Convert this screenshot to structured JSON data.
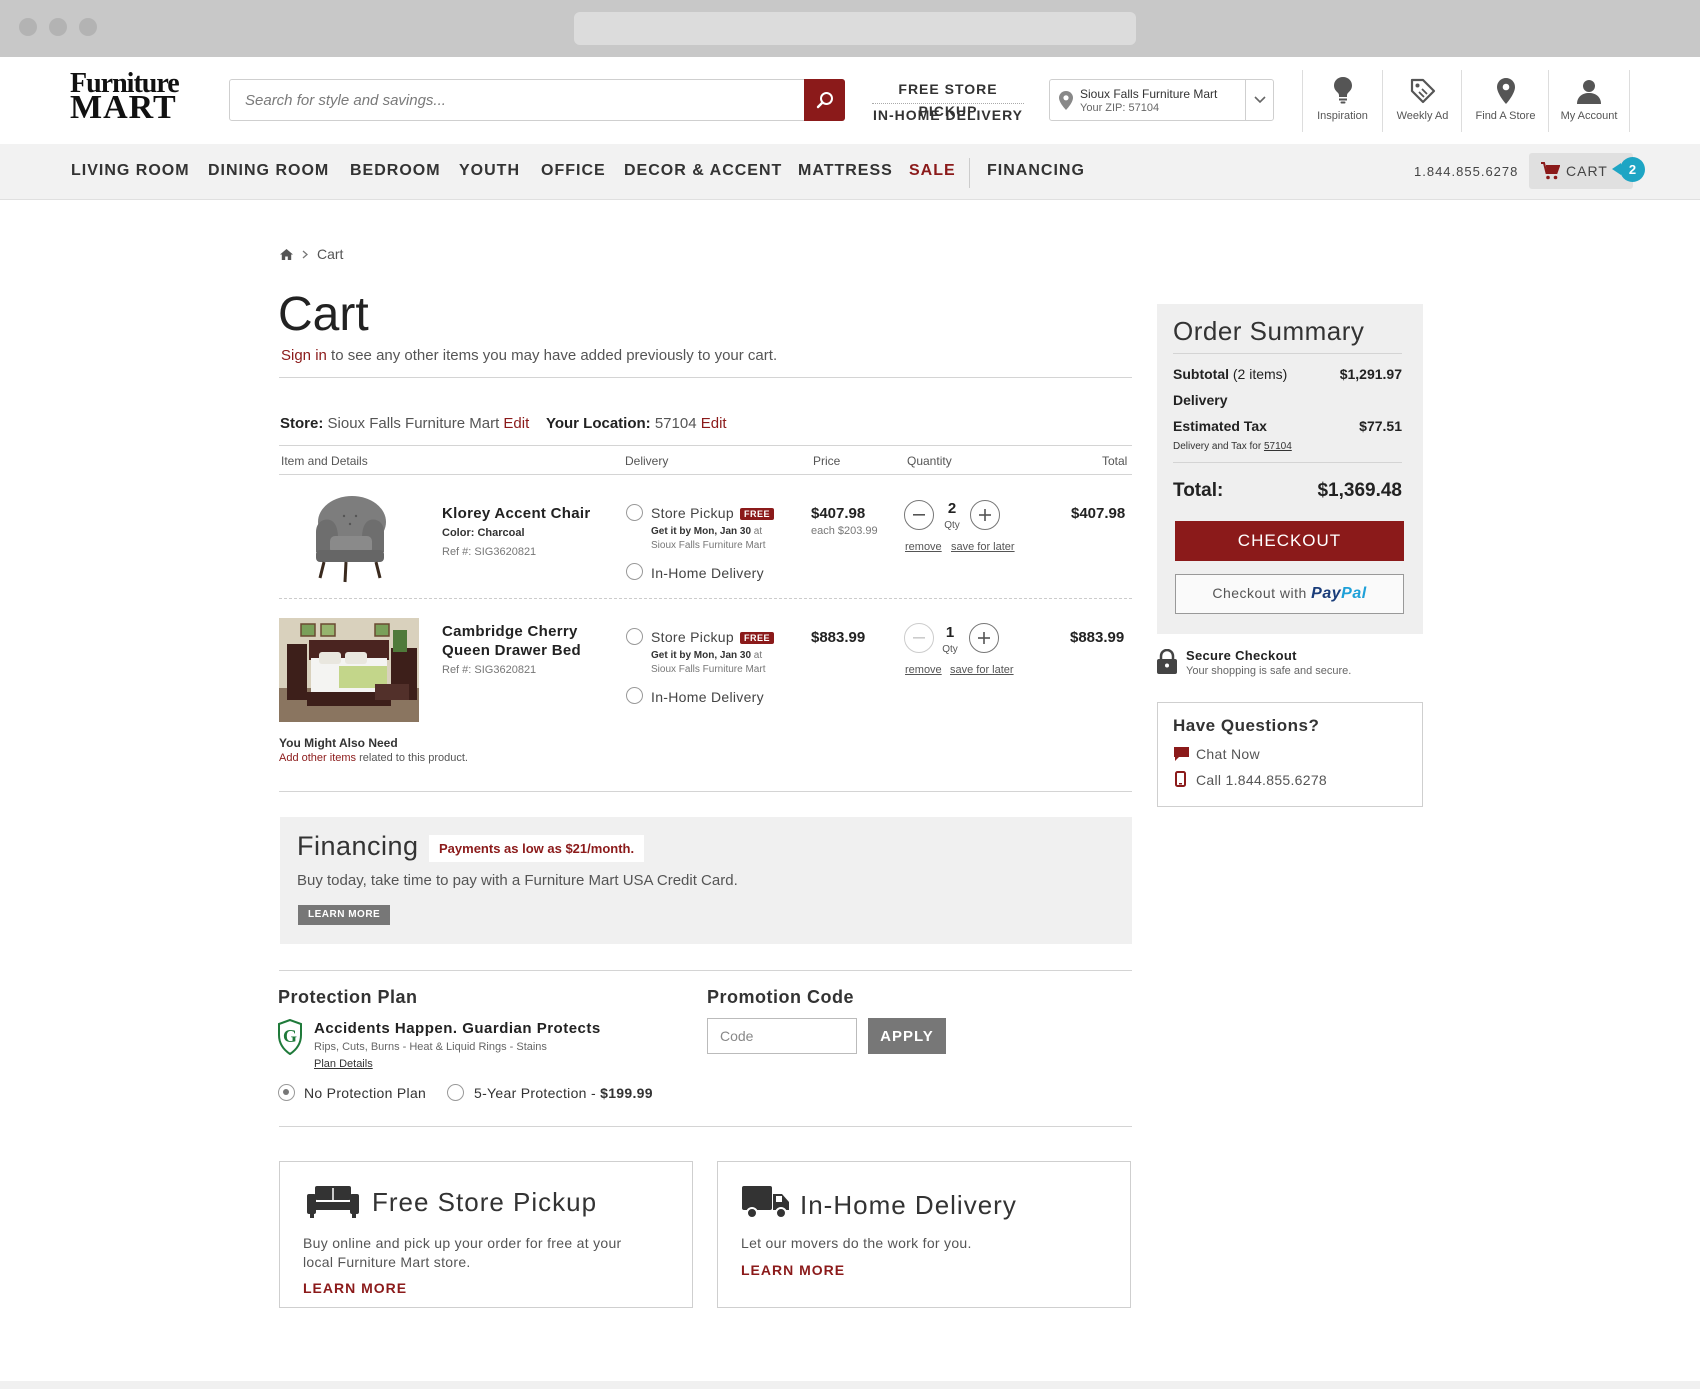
{
  "logo": {
    "line1": "Furniture",
    "line2": "MART"
  },
  "search": {
    "placeholder": "Search for style and savings..."
  },
  "header_links": {
    "pickup": "FREE STORE PICKUP",
    "delivery": "IN-HOME DELIVERY"
  },
  "store_selector": {
    "store": "Sioux Falls Furniture Mart",
    "zip": "Your ZIP: 57104"
  },
  "utility": [
    {
      "label": "Inspiration",
      "icon": "lightbulb-icon"
    },
    {
      "label": "Weekly Ad",
      "icon": "tag-icon"
    },
    {
      "label": "Find A Store",
      "icon": "map-pin-icon"
    },
    {
      "label": "My Account",
      "icon": "user-icon"
    }
  ],
  "nav": {
    "items": [
      "LIVING ROOM",
      "DINING ROOM",
      "BEDROOM",
      "YOUTH",
      "OFFICE",
      "DECOR & ACCENT",
      "MATTRESS",
      "SALE"
    ],
    "financing": "FINANCING",
    "phone": "1.844.855.6278",
    "cart_label": "CART",
    "cart_count": "2"
  },
  "breadcrumb": {
    "current": "Cart"
  },
  "page": {
    "title": "Cart",
    "signin_link": "Sign in",
    "signin_text": " to see any other items you may have added previously to your cart."
  },
  "location": {
    "store_label": "Store:",
    "store_name": "Sioux Falls Furniture Mart",
    "edit": "Edit",
    "location_label": "Your Location:",
    "zip": "57104"
  },
  "table_headers": [
    "Item and Details",
    "Delivery",
    "Price",
    "Quantity",
    "Total"
  ],
  "cart_items": [
    {
      "name": "Klorey Accent Chair",
      "color": "Color: Charcoal",
      "ref": "Ref #: SIG3620821",
      "pickup": "Store Pickup",
      "free": "FREE",
      "get_it": "Get it by Mon, Jan 30",
      "at": " at",
      "store": "Sioux Falls Furniture Mart",
      "home": "In-Home Delivery",
      "price": "$407.98",
      "each": "each $203.99",
      "qty": "2",
      "qty_label": "Qty",
      "remove": "remove",
      "save": "save for later",
      "total": "$407.98"
    },
    {
      "name_line1": "Cambridge Cherry",
      "name_line2": "Queen Drawer Bed",
      "ref": "Ref #: SIG3620821",
      "pickup": "Store Pickup",
      "free": "FREE",
      "get_it": "Get it by Mon, Jan 30",
      "at": " at",
      "store": "Sioux Falls Furniture Mart",
      "home": "In-Home Delivery",
      "price": "$883.99",
      "qty": "1",
      "qty_label": "Qty",
      "remove": "remove",
      "save": "save for later",
      "total": "$883.99"
    }
  ],
  "also_need": {
    "title": "You Might Also Need",
    "link": "Add other items",
    "text": " related to this product."
  },
  "financing": {
    "title": "Financing",
    "pill": "Payments as low as $21/month.",
    "desc": "Buy today, take time to pay with a Furniture Mart USA Credit Card.",
    "button": "LEARN MORE"
  },
  "protection": {
    "title": "Protection Plan",
    "headline": "Accidents Happen. Guardian Protects",
    "sub": "Rips, Cuts, Burns - Heat & Liquid Rings - Stains",
    "details": "Plan Details",
    "opt1": "No Protection Plan",
    "opt2": "5-Year Protection - ",
    "opt2_price": "$199.99"
  },
  "promo": {
    "title": "Promotion Code",
    "placeholder": "Code",
    "button": "APPLY"
  },
  "cards": {
    "pickup": {
      "title": "Free Store Pickup",
      "line1": "Buy online and pick up your order for free at your",
      "line2": "local Furniture Mart store.",
      "link": "LEARN MORE"
    },
    "delivery": {
      "title": "In-Home Delivery",
      "line1": "Let our movers do the work for you.",
      "link": "LEARN MORE"
    }
  },
  "summary": {
    "title": "Order Summary",
    "subtotal_label": "Subtotal",
    "subtotal_items": " (2 items)",
    "subtotal": "$1,291.97",
    "delivery_label": "Delivery",
    "tax_label": "Estimated Tax",
    "tax": "$77.51",
    "tax_note": "Delivery and Tax for ",
    "tax_zip": "57104",
    "total_label": "Total:",
    "total": "$1,369.48",
    "checkout": "CHECKOUT",
    "paypal_prefix": "Checkout with",
    "paypal_1": "Pay",
    "paypal_2": "Pal"
  },
  "secure": {
    "title": "Secure Checkout",
    "desc": "Your shopping is safe and secure."
  },
  "questions": {
    "title": "Have Questions?",
    "chat": "Chat Now",
    "call": "Call 1.844.855.6278"
  },
  "colors": {
    "brand_red": "#8b1a1a",
    "badge_teal": "#1ea5c4"
  }
}
